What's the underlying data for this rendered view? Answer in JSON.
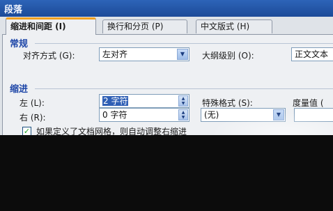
{
  "window": {
    "title": "段落"
  },
  "tabs": [
    {
      "label": "缩进和间距 (I)"
    },
    {
      "label": "换行和分页 (P)"
    },
    {
      "label": "中文版式 (H)"
    }
  ],
  "general": {
    "heading": "常规",
    "alignment_label": "对齐方式 (G):",
    "alignment_value": "左对齐",
    "outline_label": "大纲级别 (O):",
    "outline_value": "正文文本"
  },
  "indent": {
    "heading": "缩进",
    "left_label": "左 (L):",
    "left_value": "2 字符",
    "right_label": "右 (R):",
    "right_value": "0 字符",
    "special_label": "特殊格式 (S):",
    "special_value": "(无)",
    "measure_label": "度量值 (",
    "grid_checkbox_label": "如果定义了文档网格，则自动调整右缩进"
  }
}
